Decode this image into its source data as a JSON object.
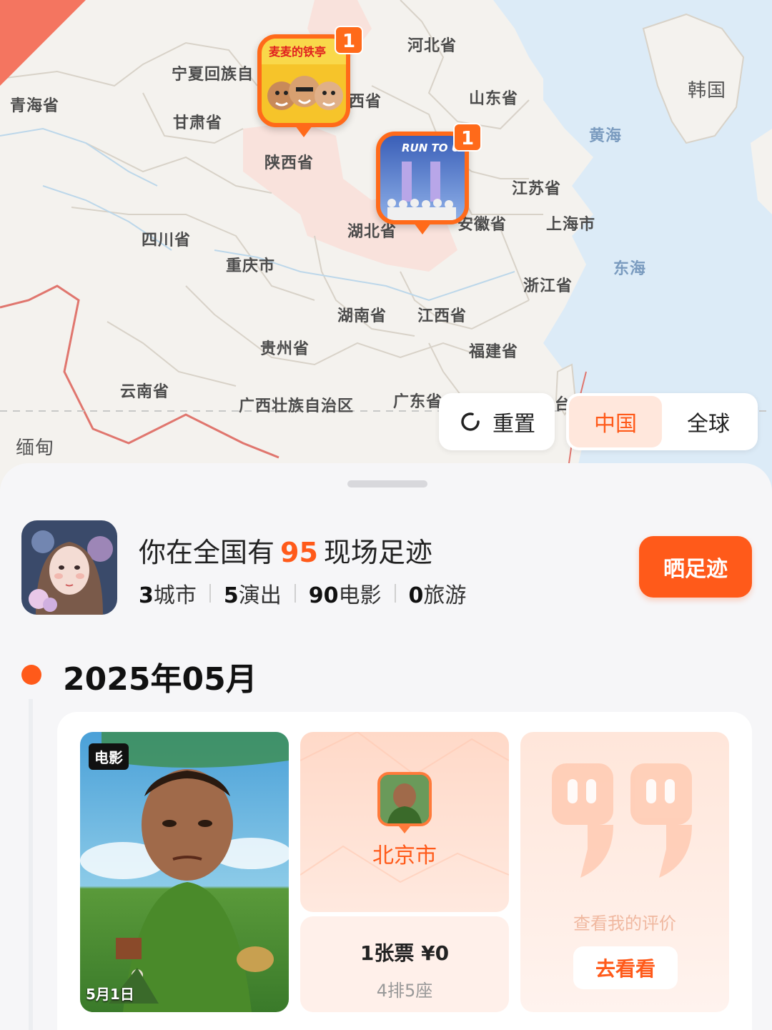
{
  "map": {
    "labels": {
      "qinghai": "青海省",
      "ningxia": "宁夏回族自",
      "gansu": "甘肃省",
      "hebei": "河北省",
      "shanxi": "西省",
      "shandong": "山东省",
      "shaanxi": "陕西省",
      "jiangsu": "江苏省",
      "anhui": "安徽省",
      "shanghai": "上海市",
      "hubei": "湖北省",
      "sichuan": "四川省",
      "chongqing": "重庆市",
      "zhejiang": "浙江省",
      "hunan": "湖南省",
      "jiangxi": "江西省",
      "guizhou": "贵州省",
      "fujian": "福建省",
      "yunnan": "云南省",
      "guangxi": "广西壮族自治区",
      "guangdong": "广东省",
      "taiwan": "台",
      "myanmar": "缅甸",
      "korea": "韩国",
      "yellow_sea": "黄海",
      "east_sea": "东海"
    },
    "pins": [
      {
        "count": "1",
        "poster_title": "麦麦的铁亭"
      },
      {
        "count": "1",
        "poster_title": "RUN TO U"
      }
    ],
    "reset_label": "重置",
    "scope_options": [
      "中国",
      "全球"
    ],
    "scope_selected": "中国",
    "accent_color": "#ff5a1a"
  },
  "summary": {
    "headline_prefix": "你在全国有",
    "headline_count": "95",
    "headline_suffix": "现场足迹",
    "stats": [
      {
        "value": "3",
        "label": "城市"
      },
      {
        "value": "5",
        "label": "演出"
      },
      {
        "value": "90",
        "label": "电影"
      },
      {
        "value": "0",
        "label": "旅游"
      }
    ],
    "share_label": "晒足迹"
  },
  "timeline": {
    "month": "2025年05月",
    "entry": {
      "poster_tag": "电影",
      "poster_date": "5月1日",
      "city": "北京市",
      "ticket": "1张票 ¥0",
      "seat": "4排5座",
      "review_prompt": "查看我的评价",
      "review_button": "去看看"
    }
  }
}
